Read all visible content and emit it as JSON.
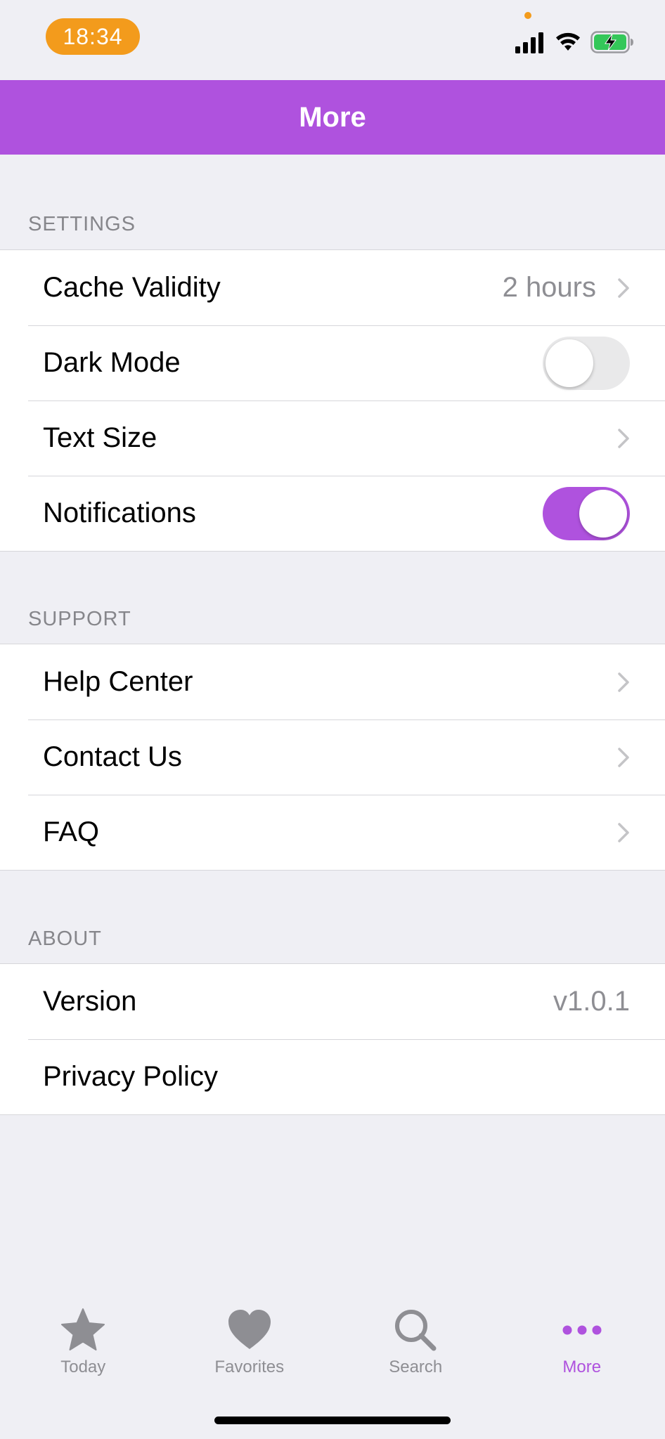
{
  "status_bar": {
    "time": "18:34"
  },
  "nav": {
    "title": "More"
  },
  "sections": {
    "settings": {
      "header": "SETTINGS",
      "cache_validity": {
        "label": "Cache Validity",
        "value": "2 hours"
      },
      "dark_mode": {
        "label": "Dark Mode",
        "enabled": false
      },
      "text_size": {
        "label": "Text Size"
      },
      "notifications": {
        "label": "Notifications",
        "enabled": true
      }
    },
    "support": {
      "header": "SUPPORT",
      "help_center": {
        "label": "Help Center"
      },
      "contact_us": {
        "label": "Contact Us"
      },
      "faq": {
        "label": "FAQ"
      }
    },
    "about": {
      "header": "ABOUT",
      "version": {
        "label": "Version",
        "value": "v1.0.1"
      },
      "privacy_policy": {
        "label": "Privacy Policy"
      }
    }
  },
  "tab_bar": {
    "tabs": [
      {
        "label": "Today",
        "icon": "star-icon",
        "active": false
      },
      {
        "label": "Favorites",
        "icon": "heart-icon",
        "active": false
      },
      {
        "label": "Search",
        "icon": "magnifier-icon",
        "active": false
      },
      {
        "label": "More",
        "icon": "ellipsis-icon",
        "active": true
      }
    ]
  },
  "colors": {
    "accent": "#af52de",
    "time_pill": "#f39b1c",
    "background": "#efeff4",
    "secondary_text": "#8e8e93"
  }
}
